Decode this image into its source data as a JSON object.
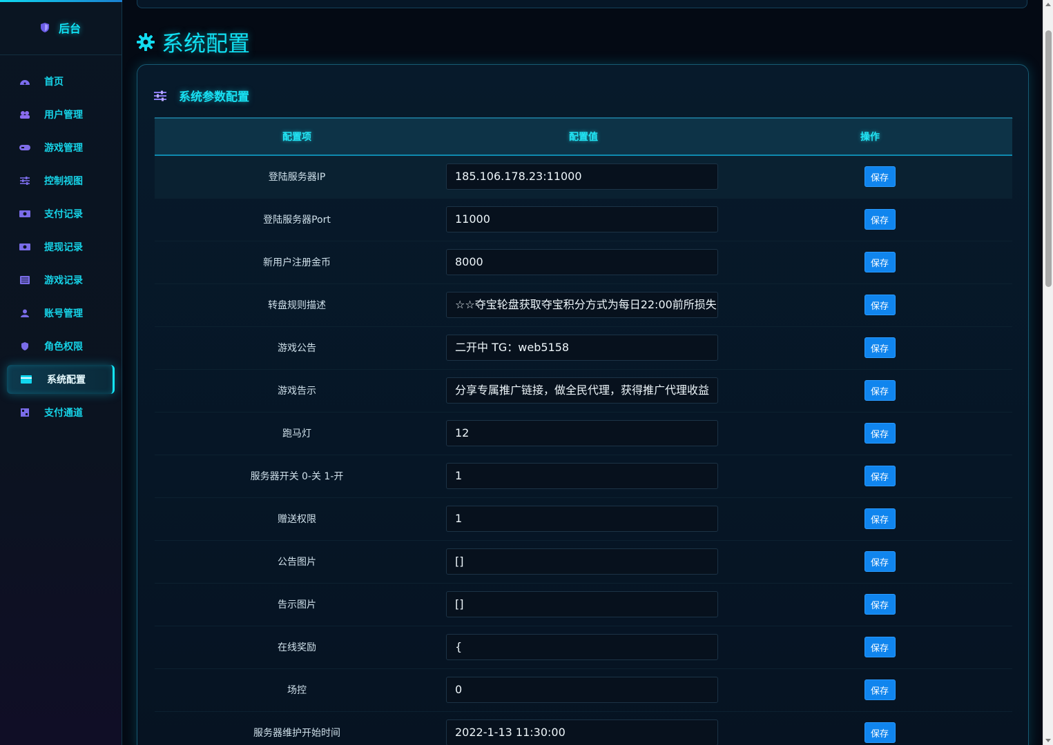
{
  "sidebar": {
    "brand": "后台",
    "items": [
      {
        "label": "首页",
        "icon": "dashboard-icon",
        "color": "#7b6cf0"
      },
      {
        "label": "用户管理",
        "icon": "users-icon",
        "color": "#8a6cf0"
      },
      {
        "label": "游戏管理",
        "icon": "gamepad-icon",
        "color": "#7e6ce8"
      },
      {
        "label": "控制视图",
        "icon": "sliders-icon",
        "color": "#7a6ce8"
      },
      {
        "label": "支付记录",
        "icon": "money-icon",
        "color": "#7a6ce8"
      },
      {
        "label": "提现记录",
        "icon": "money-icon",
        "color": "#7a6ce8"
      },
      {
        "label": "游戏记录",
        "icon": "list-icon",
        "color": "#7a6ce8"
      },
      {
        "label": "账号管理",
        "icon": "user-icon",
        "color": "#7a6ce8"
      },
      {
        "label": "角色权限",
        "icon": "shield-icon",
        "color": "#7a6ce8"
      },
      {
        "label": "系统配置",
        "icon": "card-icon",
        "color": "#12d6ee",
        "active": true
      },
      {
        "label": "支付通道",
        "icon": "qrcode-icon",
        "color": "#7a6ce8"
      }
    ]
  },
  "page": {
    "title": "系统配置"
  },
  "card": {
    "title": "系统参数配置"
  },
  "table": {
    "headers": [
      "配置项",
      "配置值",
      "操作"
    ],
    "save_label": "保存",
    "rows": [
      {
        "key": "登陆服务器IP",
        "value": "185.106.178.23:11000"
      },
      {
        "key": "登陆服务器Port",
        "value": "11000"
      },
      {
        "key": "新用户注册金币",
        "value": "8000"
      },
      {
        "key": "转盘规则描述",
        "value": "☆☆夺宝轮盘获取夺宝积分方式为每日22:00前所损失"
      },
      {
        "key": "游戏公告",
        "value": "二开中 TG：web5158"
      },
      {
        "key": "游戏告示",
        "value": "分享专属推广链接，做全民代理，获得推广代理收益"
      },
      {
        "key": "跑马灯",
        "value": "12"
      },
      {
        "key": "服务器开关 0-关 1-开",
        "value": "1"
      },
      {
        "key": "赠送权限",
        "value": "1"
      },
      {
        "key": "公告图片",
        "value": "[]"
      },
      {
        "key": "告示图片",
        "value": "[]"
      },
      {
        "key": "在线奖励",
        "value": "{"
      },
      {
        "key": "场控",
        "value": "0"
      },
      {
        "key": "服务器维护开始时间",
        "value": "2022-1-13 11:30:00"
      }
    ]
  }
}
